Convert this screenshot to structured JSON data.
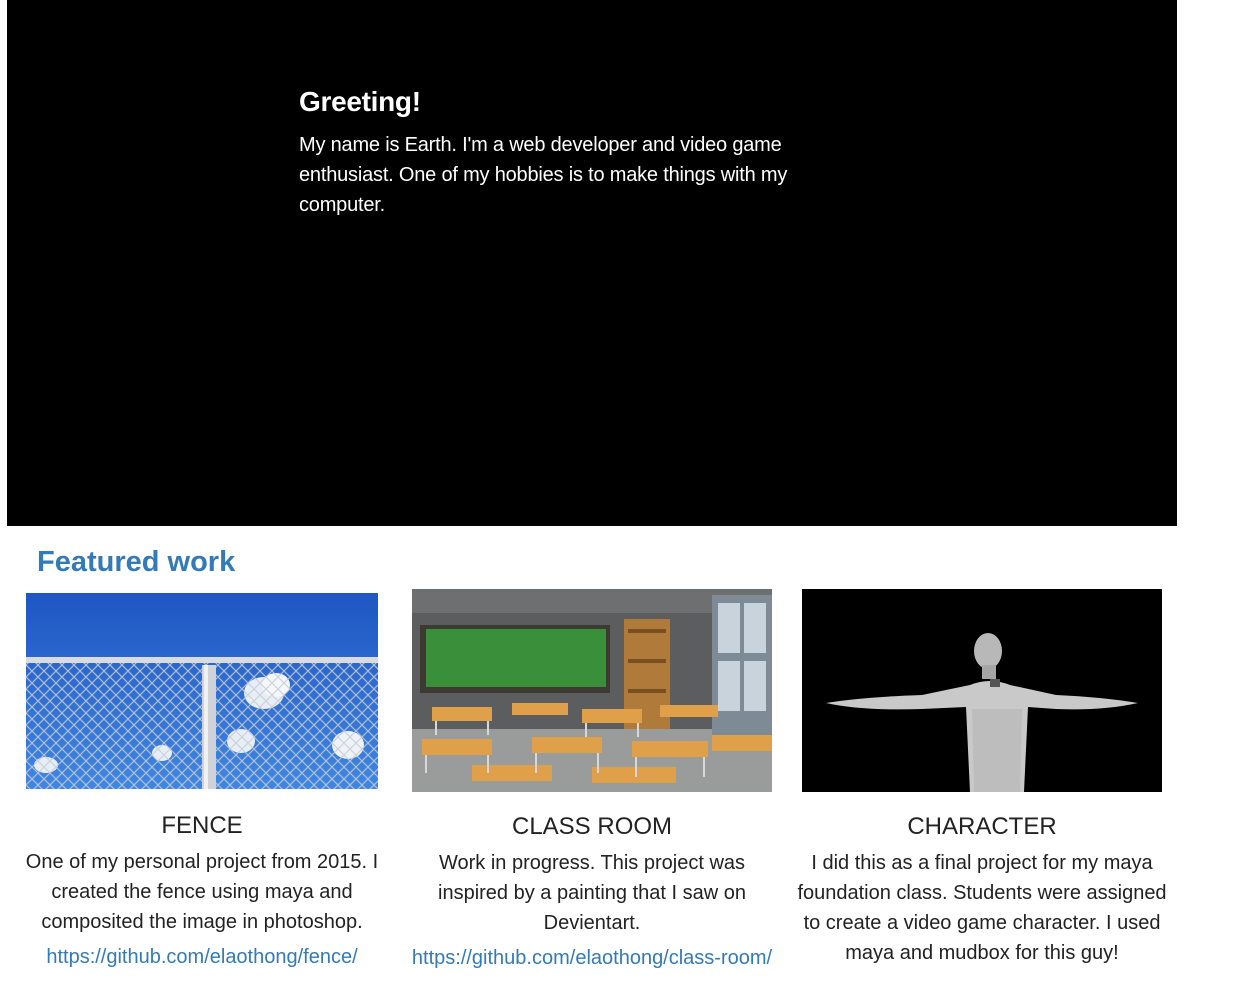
{
  "hero": {
    "title": "Greeting!",
    "body": "My name is Earth. I'm a web developer and video game enthusiast. One of my hobbies is to make things with my computer."
  },
  "featured": {
    "title": "Featured work",
    "cards": [
      {
        "title": "FENCE",
        "description": "One of my personal project from 2015. I created the fence using maya and composited the image in photoshop.",
        "link": "https://github.com/elaothong/fence/"
      },
      {
        "title": "CLASS ROOM",
        "description": "Work in progress. This project was inspired by a painting that I saw on Devientart.",
        "link": "https://github.com/elaothong/class-room/"
      },
      {
        "title": "CHARACTER",
        "description": "I did this as a final project for my maya foundation class. Students were assigned to create a video game character. I used maya and mudbox for this guy!",
        "link": ""
      }
    ]
  },
  "colors": {
    "hero_bg": "#000000",
    "accent": "#337ab7"
  }
}
